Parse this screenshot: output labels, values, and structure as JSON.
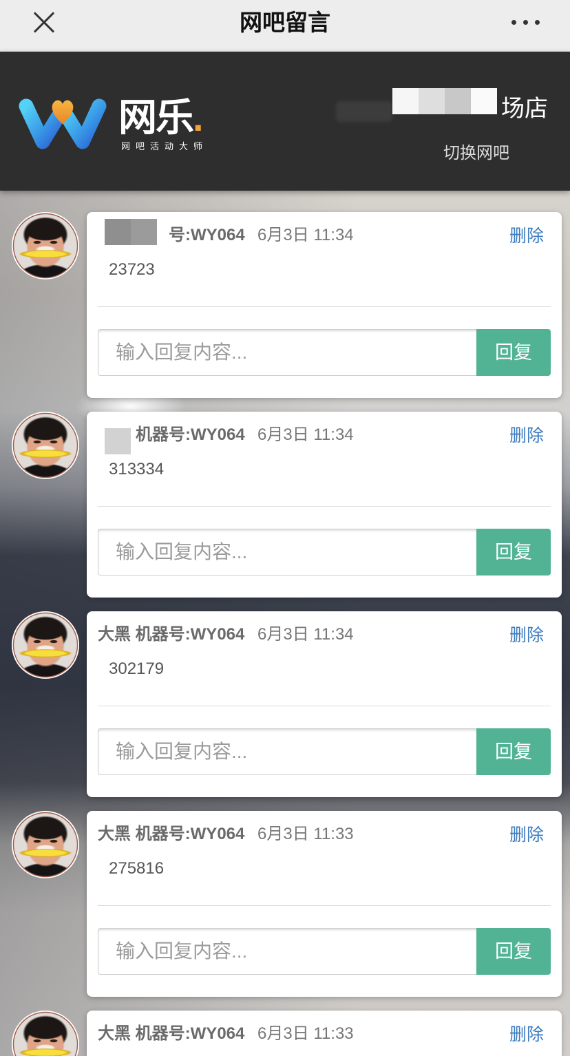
{
  "topbar": {
    "title": "网吧留言",
    "close_icon": "close-icon",
    "more_icon": "more-icon"
  },
  "header": {
    "logo_icon": "wangle-w-logo-icon",
    "logo_text": "网乐",
    "logo_dot": ".",
    "logo_tagline": "网吧活动大师",
    "store_name": "场店",
    "switch_label": "切换网吧"
  },
  "colors": {
    "topbar_bg": "#ededed",
    "header_bg": "#2e2e2e",
    "reply_button_bg": "#52b394",
    "delete_link": "#3b7bbf"
  },
  "messages": [
    {
      "author": "号:WY064",
      "time": "6月3日 11:34",
      "content": "23723",
      "delete_label": "删除",
      "reply_placeholder": "输入回复内容...",
      "reply_label": "回复"
    },
    {
      "author": "机器号:WY064",
      "time": "6月3日 11:34",
      "content": "313334",
      "delete_label": "删除",
      "reply_placeholder": "输入回复内容...",
      "reply_label": "回复"
    },
    {
      "author": "大黑 机器号:WY064",
      "time": "6月3日 11:34",
      "content": "302179",
      "delete_label": "删除",
      "reply_placeholder": "输入回复内容...",
      "reply_label": "回复"
    },
    {
      "author": "大黑 机器号:WY064",
      "time": "6月3日 11:33",
      "content": "275816",
      "delete_label": "删除",
      "reply_placeholder": "输入回复内容...",
      "reply_label": "回复"
    },
    {
      "author": "大黑 机器号:WY064",
      "time": "6月3日 11:33",
      "delete_label": "删除"
    }
  ]
}
